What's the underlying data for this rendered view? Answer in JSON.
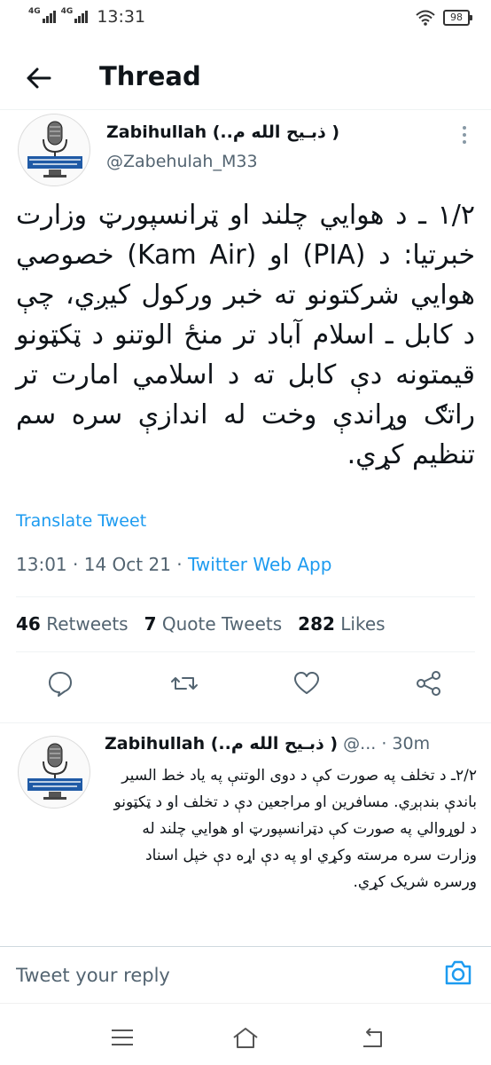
{
  "status_bar": {
    "net1": "4G",
    "net2": "4G",
    "time": "13:31",
    "battery": "98"
  },
  "header": {
    "title": "Thread"
  },
  "main_tweet": {
    "author_name": "Zabihullah (..ذبـيح الله م )",
    "author_handle": "@Zabehulah_M33",
    "text": "١/٢ ـ د هوايي چلند او ټرانسپورټ وزارت خبرتیا: د (PIA) او (Kam Air) خصوصي هوايي شرکتونو ته خبر ورکول کیږي، چې د کابل ـ اسلام آباد تر منځ الوتنو د ټکټونو قیمتونه دې کابل ته د اسلامي امارت تر راتګ وړاندې وخت له اندازې سره سم تنظیم کړي.",
    "translate_label": "Translate Tweet",
    "time": "13:01",
    "date": "14 Oct 21",
    "separator": " · ",
    "source": "Twitter Web App",
    "retweets_count": "46",
    "retweets_label": "Retweets",
    "quote_count": "7",
    "quote_label": "Quote Tweets",
    "likes_count": "282",
    "likes_label": "Likes"
  },
  "reply_tweet": {
    "author_name": "Zabihullah (..ذبـيح الله م )",
    "handle_time": "@... · 30m",
    "text": "٢/٢ـ د تخلف په صورت کې د دوی الوتنې په یاد خط السیر باندې بندېږي. مسافرین او مراجعین دې د تخلف او د ټکټونو د لوړوالي په صورت کې دټرانسپورټ او هوايي چلند له وزارت  سره مرسته وکړي او  په دې اړه دې خپل اسناد ورسره شریک کړي."
  },
  "composer": {
    "placeholder": "Tweet your reply"
  },
  "colors": {
    "accent": "#1d9bf0",
    "text_primary": "#0f1419",
    "text_secondary": "#536471",
    "avatar_badge": "#1f5aa6"
  },
  "icons": {
    "back": "arrow-left-icon",
    "more": "more-vertical-icon",
    "reply": "comment-icon",
    "retweet": "retweet-icon",
    "like": "heart-icon",
    "share": "share-icon",
    "camera": "camera-icon",
    "nav_menu": "menu-icon",
    "nav_home": "home-icon",
    "nav_back": "back-icon"
  }
}
